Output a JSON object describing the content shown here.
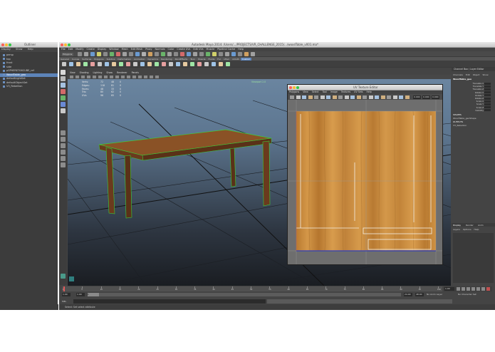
{
  "outliner": {
    "title": "Outliner",
    "menu": [
      "Display",
      "Show",
      "Help"
    ],
    "items": [
      {
        "label": "persp",
        "selected": false
      },
      {
        "label": "top",
        "selected": false
      },
      {
        "label": "front",
        "selected": false
      },
      {
        "label": "side",
        "selected": false
      },
      {
        "label": "pSPHERE706CUBE_ref",
        "selected": false
      },
      {
        "label": "WoodTable_geo",
        "selected": true
      },
      {
        "label": "defaultLightSet",
        "selected": false
      },
      {
        "label": "defaultObjectSet",
        "selected": false
      },
      {
        "label": "V3_Rebellion",
        "selected": false
      }
    ]
  },
  "main": {
    "title": "Autodesk Maya 2014: /Users/.../PROJECTS/VR_CHALLENGE_2015/.../woodTable_v001.ma*",
    "menu": [
      "File",
      "Edit",
      "Modify",
      "Create",
      "Display",
      "Window",
      "Mesh",
      "Edit Mesh",
      "Proxy",
      "Normals",
      "Color",
      "Create UVs",
      "Edit UVs",
      "Muscle",
      "Pipeline Cache",
      "Help"
    ],
    "mode_dropdown": "Polygons",
    "shelf_tabs": [
      "General",
      "Curves",
      "Surfaces",
      "Polygons",
      "Subdivs",
      "Deformation",
      "Animation",
      "Dynamics",
      "Rendering",
      "PaintEffects",
      "Toon",
      "Muscle",
      "Fluids",
      "Fur",
      "nHair",
      "nCloth",
      "Custom"
    ],
    "active_shelf_tab": "Custom"
  },
  "viewport": {
    "menu": [
      "View",
      "Shading",
      "Lighting",
      "Show",
      "Renderer",
      "Panels"
    ],
    "hud": [
      {
        "label": "Verts:",
        "a": "72",
        "b": "48",
        "c": "0"
      },
      {
        "label": "Edges:",
        "a": "118",
        "b": "81",
        "c": "0"
      },
      {
        "label": "Faces:",
        "a": "48",
        "b": "33",
        "c": "0"
      },
      {
        "label": "Tris:",
        "a": "80",
        "b": "62",
        "c": "0"
      },
      {
        "label": "UVs:",
        "a": "96",
        "b": "65",
        "c": "0"
      }
    ],
    "camera_label": "Viewport 2.0"
  },
  "uv_editor": {
    "title": "UV Texture Editor",
    "menu": [
      "Polygons",
      "View",
      "Select",
      "Tool",
      "Image",
      "Textures",
      "UV Sets",
      "Help"
    ],
    "fields": [
      "0.000",
      "0.000",
      "0.000"
    ]
  },
  "channel_box": {
    "header": "Channel Box / Layer Editor",
    "menu": [
      "Channels",
      "Edit",
      "Object",
      "Show"
    ],
    "object_name": "WoodTable_geo",
    "attributes": [
      "Translate X",
      "Translate Y",
      "Translate Z",
      "Rotate X",
      "Rotate Y",
      "Rotate Z",
      "Scale X",
      "Scale Y",
      "Scale Z",
      "Visibility"
    ],
    "shapes_header": "SHAPES",
    "shape_name": "WoodTable_geoShape",
    "outputs_header": "OUTPUTS",
    "output_name": "V3_Rebellion",
    "layer_tabs": [
      "Display",
      "Render",
      "Anim"
    ],
    "layer_menu": [
      "Layers",
      "Options",
      "Help"
    ]
  },
  "timeslider": {
    "ticks": [
      "1",
      "5",
      "10",
      "15",
      "20",
      "25",
      "30",
      "35",
      "40",
      "45",
      "50",
      "55",
      "60",
      "65",
      "70",
      "75",
      "80",
      "85",
      "90",
      "95",
      "100"
    ],
    "start": "1.00",
    "current": "1.00",
    "range_start": "1",
    "range_end": "24",
    "end_a": "24.00",
    "end_b": "48.00",
    "anim_layer": "No Anim Layer",
    "character_set": "No Character Set",
    "current_frame": "1.00"
  },
  "command_line": {
    "lang": "MEL"
  },
  "help_line": "Select: Set select attribute",
  "colors": {
    "selection": "#5d84b9",
    "wood_light": "#c98a3a",
    "wood_dark": "#6a3a1d",
    "wireframe": "#3bd13b"
  }
}
